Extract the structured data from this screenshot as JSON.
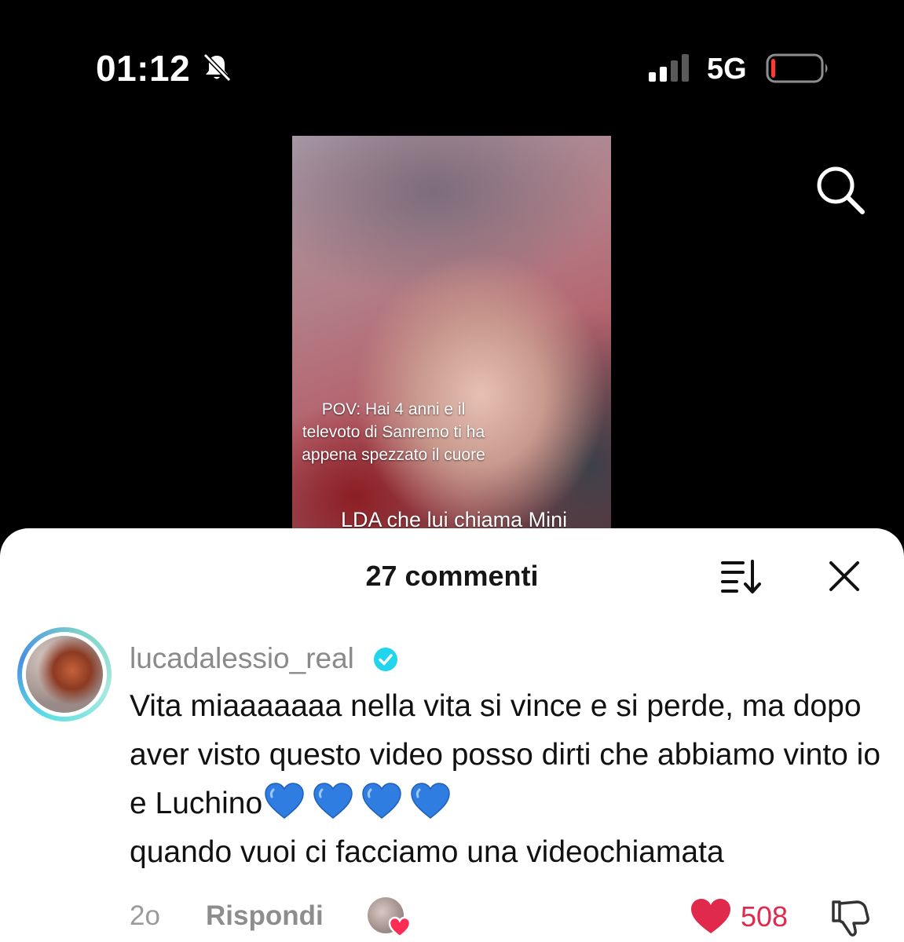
{
  "status_bar": {
    "time": "01:12",
    "network": "5G",
    "icons": [
      "bell-slash-icon",
      "signal-icon",
      "battery-icon"
    ],
    "battery_level": 0.08,
    "battery_color": "#ff3b30"
  },
  "top_bar": {
    "icons": [
      "search-icon"
    ]
  },
  "video": {
    "caption": "POV: Hai 4 anni  e il\ntelevoto di Sanremo ti ha\nappena spezzato il cuore",
    "subcaption": "LDA che lui chiama Mini"
  },
  "comments_sheet": {
    "title": "27 commenti",
    "icons": [
      "sort-icon",
      "close-icon"
    ],
    "comment": {
      "username": "lucadalessio_real",
      "verified": true,
      "text": "Vita miaaaaaaa nella vita si vince e si perde, ma dopo aver visto questo video posso dirti che abbiamo vinto io e Luchino",
      "text_after_emoji": "quando vuoi ci facciamo una videochiamata",
      "emoji": "💙💙💙💙",
      "age": "2o",
      "reply_label": "Rispondi",
      "like_count": "508",
      "liked": true,
      "like_color": "#e0294b"
    }
  }
}
